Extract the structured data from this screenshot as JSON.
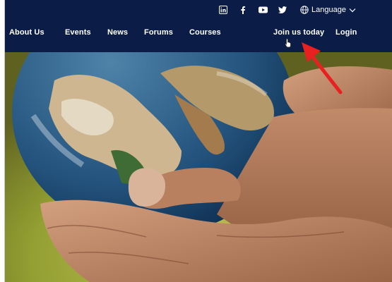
{
  "social_icons": [
    {
      "name": "linkedin-icon",
      "glyph": "in"
    },
    {
      "name": "facebook-icon",
      "glyph": "f"
    },
    {
      "name": "youtube-icon",
      "glyph": "▶"
    },
    {
      "name": "twitter-icon",
      "glyph": "🐦"
    }
  ],
  "language": {
    "label": "Language",
    "icon": "globe-icon",
    "caret": "chevron-down-icon"
  },
  "nav": {
    "about": "About Us",
    "events": "Events",
    "news": "News",
    "forums": "Forums",
    "courses": "Courses",
    "join": "Join us today",
    "login": "Login"
  },
  "hero_image": {
    "subject": "hands holding Earth globe"
  },
  "annotation": {
    "type": "red-arrow",
    "color": "#e82020"
  },
  "colors": {
    "navbar": "#0b1d47",
    "nav_text": "#ffffff"
  }
}
